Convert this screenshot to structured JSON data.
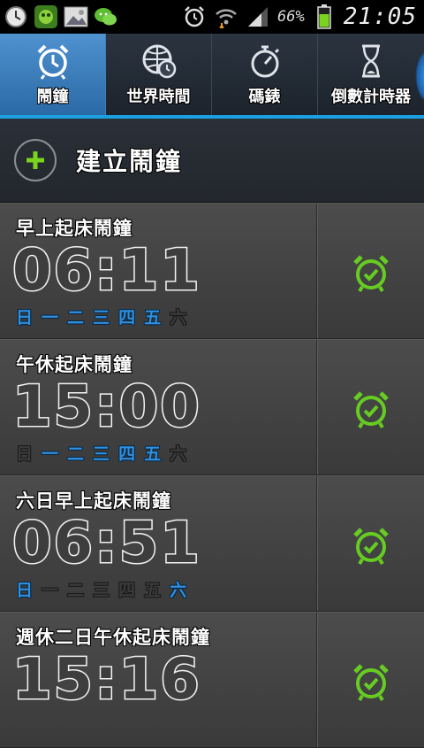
{
  "statusbar": {
    "battery_percent": "66%",
    "time": "21:05"
  },
  "tabs": [
    {
      "label": "鬧鐘",
      "icon": "alarm-clock-icon",
      "active": true
    },
    {
      "label": "世界時間",
      "icon": "world-clock-icon",
      "active": false
    },
    {
      "label": "碼錶",
      "icon": "stopwatch-icon",
      "active": false
    },
    {
      "label": "倒數計時器",
      "icon": "hourglass-icon",
      "active": false
    }
  ],
  "add_alarm": {
    "label": "建立鬧鐘"
  },
  "alarms": [
    {
      "name": "早上起床鬧鐘",
      "time": "06:11",
      "days": [
        {
          "label": "日",
          "on": true
        },
        {
          "label": "一",
          "on": true
        },
        {
          "label": "二",
          "on": true
        },
        {
          "label": "三",
          "on": true
        },
        {
          "label": "四",
          "on": true
        },
        {
          "label": "五",
          "on": true
        },
        {
          "label": "六",
          "on": false
        }
      ],
      "enabled": true
    },
    {
      "name": "午休起床鬧鐘",
      "time": "15:00",
      "days": [
        {
          "label": "日",
          "on": false
        },
        {
          "label": "一",
          "on": true
        },
        {
          "label": "二",
          "on": true
        },
        {
          "label": "三",
          "on": true
        },
        {
          "label": "四",
          "on": true
        },
        {
          "label": "五",
          "on": true
        },
        {
          "label": "六",
          "on": false
        }
      ],
      "enabled": true
    },
    {
      "name": "六日早上起床鬧鐘",
      "time": "06:51",
      "days": [
        {
          "label": "日",
          "on": true
        },
        {
          "label": "一",
          "on": false
        },
        {
          "label": "二",
          "on": false
        },
        {
          "label": "三",
          "on": false
        },
        {
          "label": "四",
          "on": false
        },
        {
          "label": "五",
          "on": false
        },
        {
          "label": "六",
          "on": true
        }
      ],
      "enabled": true
    },
    {
      "name": "週休二日午休起床鬧鐘",
      "time": "15:16",
      "days": [],
      "enabled": true
    }
  ],
  "colors": {
    "accent": "#1ba0e1",
    "day_on": "#2f8fe0",
    "alarm_on": "#66cc22"
  }
}
